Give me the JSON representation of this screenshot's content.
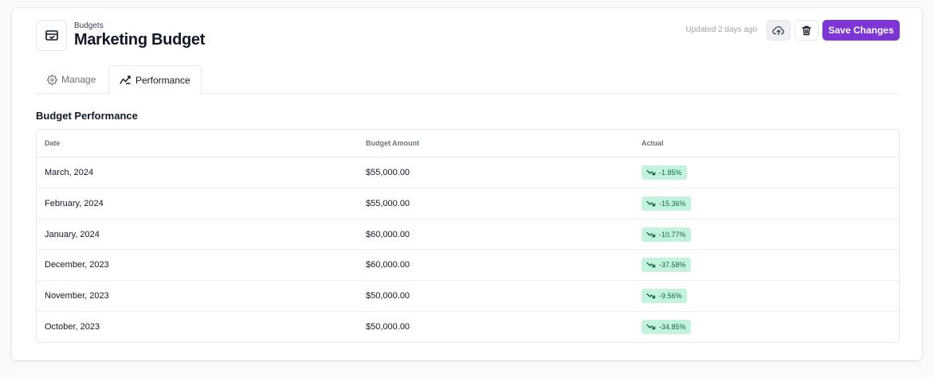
{
  "header": {
    "breadcrumb": "Budgets",
    "title": "Marketing Budget",
    "updated": "Updated 2 days ago",
    "save_label": "Save Changes",
    "icons": {
      "app": "wallet-check-icon",
      "cloud": "cloud-upload-icon",
      "trash": "trash-icon"
    }
  },
  "tabs": [
    {
      "label": "Manage",
      "icon": "gear-icon",
      "active": false
    },
    {
      "label": "Performance",
      "icon": "trend-chart-icon",
      "active": true
    }
  ],
  "section": {
    "title": "Budget Performance"
  },
  "table": {
    "columns": [
      "Date",
      "Budget Amount",
      "Actual"
    ],
    "rows": [
      {
        "date": "March, 2024",
        "amount": "$55,000.00",
        "actual": "-1.85%"
      },
      {
        "date": "February, 2024",
        "amount": "$55,000.00",
        "actual": "-15.36%"
      },
      {
        "date": "January, 2024",
        "amount": "$60,000.00",
        "actual": "-10.77%"
      },
      {
        "date": "December, 2023",
        "amount": "$60,000.00",
        "actual": "-37.58%"
      },
      {
        "date": "November, 2023",
        "amount": "$50,000.00",
        "actual": "-9.56%"
      },
      {
        "date": "October, 2023",
        "amount": "$50,000.00",
        "actual": "-34.85%"
      }
    ]
  },
  "colors": {
    "accent": "#7e35d6",
    "badge_bg": "#c3f2dd",
    "badge_text": "#0f6b47"
  }
}
